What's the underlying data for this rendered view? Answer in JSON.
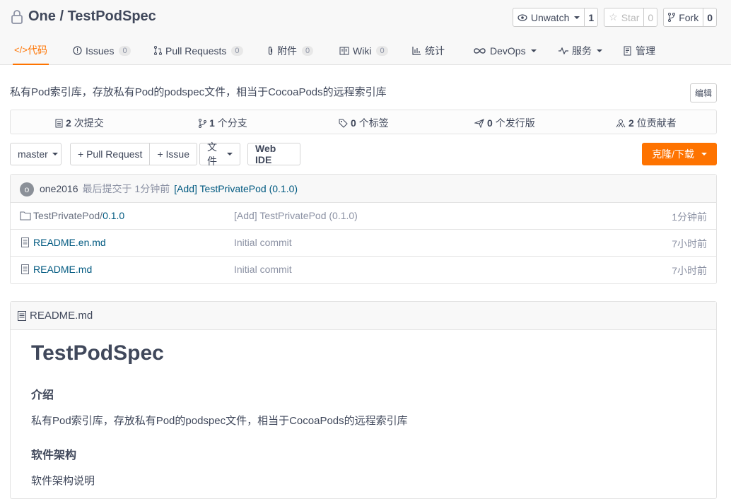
{
  "repo": {
    "owner": "One",
    "separator": " / ",
    "name": "TestPodSpec",
    "full": "One / TestPodSpec",
    "description": "私有Pod索引库，存放私有Pod的podspec文件，相当于CocoaPods的远程索引库",
    "edit_label": "编辑"
  },
  "actions": {
    "watch": {
      "label": "Unwatch",
      "count": "1"
    },
    "star": {
      "label": "Star",
      "count": "0"
    },
    "fork": {
      "label": "Fork",
      "count": "0"
    }
  },
  "tabs": [
    {
      "label": "代码",
      "icon": "code-icon"
    },
    {
      "label": "Issues",
      "badge": "0",
      "icon": "issue-icon"
    },
    {
      "label": "Pull Requests",
      "badge": "0",
      "icon": "pull-request-icon"
    },
    {
      "label": "附件",
      "badge": "0",
      "icon": "attachment-icon"
    },
    {
      "label": "Wiki",
      "badge": "0",
      "icon": "wiki-icon"
    },
    {
      "label": "统计",
      "icon": "stats-icon"
    },
    {
      "label": "DevOps",
      "icon": "devops-icon"
    },
    {
      "label": "服务",
      "icon": "service-icon"
    },
    {
      "label": "管理",
      "icon": "manage-icon"
    }
  ],
  "stats": {
    "commits": {
      "count": "2",
      "label": "次提交"
    },
    "branches": {
      "count": "1",
      "label": "个分支"
    },
    "tags": {
      "count": "0",
      "label": "个标签"
    },
    "releases": {
      "count": "0",
      "label": "个发行版"
    },
    "contributors": {
      "count": "2",
      "label": "位贡献者"
    }
  },
  "toolbar": {
    "branch": "master",
    "pull_request": "+ Pull Request",
    "issue": "+ Issue",
    "files": "文件",
    "web_ide": "Web IDE",
    "clone": "克隆/下载"
  },
  "last_commit": {
    "avatar_letter": "o",
    "user": "one2016",
    "meta": "最后提交于 1分钟前",
    "message": "[Add] TestPrivatePod (0.1.0)"
  },
  "files": [
    {
      "type": "folder",
      "dir": "TestPrivatePod/",
      "name": "0.1.0",
      "message": "[Add] TestPrivatePod (0.1.0)",
      "time": "1分钟前"
    },
    {
      "type": "file",
      "dir": "",
      "name": "README.en.md",
      "message": "Initial commit",
      "time": "7小时前"
    },
    {
      "type": "file",
      "dir": "",
      "name": "README.md",
      "message": "Initial commit",
      "time": "7小时前"
    }
  ],
  "readme": {
    "filename": "README.md",
    "h1": "TestPodSpec",
    "h_intro": "介绍",
    "intro": "私有Pod索引库，存放私有Pod的podspec文件，相当于CocoaPods的远程索引库",
    "h_arch": "软件架构",
    "arch": "软件架构说明"
  },
  "colors": {
    "accent": "#fe7300",
    "link": "#005980",
    "text": "#40485b",
    "muted": "#8c92a4"
  }
}
